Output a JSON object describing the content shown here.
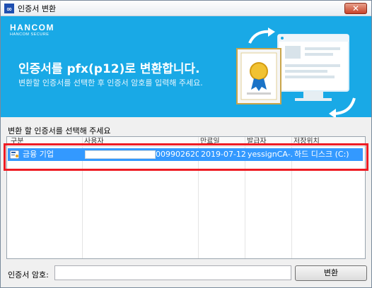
{
  "window": {
    "title": "인증서 변환",
    "close_glyph": "✕"
  },
  "banner": {
    "brand": "HANCOM",
    "brand_sub": "HANCOM SECURE",
    "headline": "인증서를 pfx(p12)로 변환합니다.",
    "subline": "변환할 인증서를 선택한 후 인증서 암호를 입력해 주세요.",
    "illustration_icon": "certificate-monitor-icon"
  },
  "list": {
    "label": "변환 할 인증서를 선택해 주세요",
    "columns": [
      "구분",
      "사용자",
      "만료일",
      "발급자",
      "저장위치"
    ],
    "rows": [
      {
        "type": "금융 기업",
        "user_suffix": "009902620...",
        "expiry": "2019-07-12",
        "issuer": "yessignCA-...",
        "location": "하드 디스크 (C:)",
        "selected": true
      }
    ]
  },
  "password": {
    "label": "인증서 암호:",
    "value": "",
    "placeholder": ""
  },
  "convert_button": {
    "label": "변환"
  },
  "colors": {
    "banner": "#19a9e6",
    "selection": "#3399ff",
    "highlight": "#ee1c24"
  }
}
